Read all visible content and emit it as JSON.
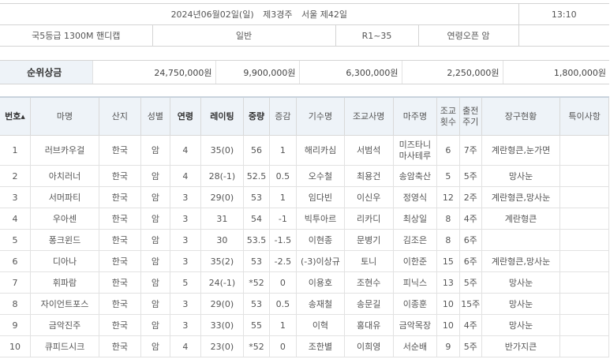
{
  "race": {
    "date": "2024년06월02일(일)",
    "week": "제3경주",
    "venue_race": "서울 제42일",
    "time": "13:10",
    "grade_distance": "국5등급  1300M  핸디캡",
    "type": "일반",
    "rating_range": "R1~35",
    "eligibility": "연령오픈 암"
  },
  "prize": {
    "label": "순위상금",
    "amounts": [
      "24,750,000원",
      "9,900,000원",
      "6,300,000원",
      "2,250,000원",
      "1,800,000원"
    ]
  },
  "columns": {
    "no": "번호",
    "sort_icon": "▲",
    "horse": "마명",
    "origin": "산지",
    "sex": "성별",
    "age": "연령",
    "rating": "레이팅",
    "weight": "중량",
    "weight_change": "증감",
    "jockey": "기수명",
    "trainer": "조교사명",
    "owner": "마주명",
    "train_count_l1": "조교",
    "train_count_l2": "횟수",
    "interval_l1": "출전",
    "interval_l2": "주기",
    "equipment": "장구현황",
    "notes": "특이사항"
  },
  "entries": [
    {
      "no": "1",
      "horse": "러브카우걸",
      "origin": "한국",
      "sex": "암",
      "age": "4",
      "rating": "35(0)",
      "weight": "56",
      "change": "1",
      "jockey": "해리카심",
      "trainer": "서범석",
      "owner_l1": "미즈타니",
      "owner_l2": "마사테루",
      "train_count": "6",
      "interval": "7주",
      "equipment": "계란형큰,눈가면",
      "notes": ""
    },
    {
      "no": "2",
      "horse": "아치러너",
      "origin": "한국",
      "sex": "암",
      "age": "4",
      "rating": "28(-1)",
      "weight": "52.5",
      "change": "0.5",
      "jockey": "오수철",
      "trainer": "최용건",
      "owner_l1": "송암축산",
      "owner_l2": "",
      "train_count": "5",
      "interval": "5주",
      "equipment": "망사눈",
      "notes": ""
    },
    {
      "no": "3",
      "horse": "서머파티",
      "origin": "한국",
      "sex": "암",
      "age": "3",
      "rating": "29(0)",
      "weight": "53",
      "change": "1",
      "jockey": "임다빈",
      "trainer": "이신우",
      "owner_l1": "정영식",
      "owner_l2": "",
      "train_count": "12",
      "interval": "2주",
      "equipment": "계란형큰,망사눈",
      "notes": ""
    },
    {
      "no": "4",
      "horse": "우아센",
      "origin": "한국",
      "sex": "암",
      "age": "3",
      "rating": "31",
      "weight": "54",
      "change": "-1",
      "jockey": "빅투아르",
      "trainer": "리카디",
      "owner_l1": "최상일",
      "owner_l2": "",
      "train_count": "8",
      "interval": "4주",
      "equipment": "계란형큰",
      "notes": ""
    },
    {
      "no": "5",
      "horse": "퐁크윈드",
      "origin": "한국",
      "sex": "암",
      "age": "3",
      "rating": "30",
      "weight": "53.5",
      "change": "-1.5",
      "jockey": "이현종",
      "trainer": "문병기",
      "owner_l1": "김조은",
      "owner_l2": "",
      "train_count": "8",
      "interval": "6주",
      "equipment": "",
      "notes": ""
    },
    {
      "no": "6",
      "horse": "디아나",
      "origin": "한국",
      "sex": "암",
      "age": "3",
      "rating": "35(2)",
      "weight": "53",
      "change": "-2.5",
      "jockey": "(-3)이상규",
      "trainer": "토니",
      "owner_l1": "이한준",
      "owner_l2": "",
      "train_count": "15",
      "interval": "6주",
      "equipment": "계란형큰,망사눈",
      "notes": ""
    },
    {
      "no": "7",
      "horse": "휘파람",
      "origin": "한국",
      "sex": "암",
      "age": "5",
      "rating": "24(-1)",
      "weight": "*52",
      "change": "0",
      "jockey": "이용호",
      "trainer": "조현수",
      "owner_l1": "피닉스",
      "owner_l2": "",
      "train_count": "13",
      "interval": "5주",
      "equipment": "망사눈",
      "notes": ""
    },
    {
      "no": "8",
      "horse": "자이언트포스",
      "origin": "한국",
      "sex": "암",
      "age": "3",
      "rating": "29(0)",
      "weight": "53",
      "change": "0.5",
      "jockey": "송재철",
      "trainer": "송문길",
      "owner_l1": "이종훈",
      "owner_l2": "",
      "train_count": "10",
      "interval": "15주",
      "equipment": "망사눈",
      "notes": ""
    },
    {
      "no": "9",
      "horse": "금악진주",
      "origin": "한국",
      "sex": "암",
      "age": "3",
      "rating": "33(0)",
      "weight": "55",
      "change": "1",
      "jockey": "이혁",
      "trainer": "홍대유",
      "owner_l1": "금악목장",
      "owner_l2": "",
      "train_count": "10",
      "interval": "4주",
      "equipment": "망사눈",
      "notes": ""
    },
    {
      "no": "10",
      "horse": "큐피드시크",
      "origin": "한국",
      "sex": "암",
      "age": "4",
      "rating": "23(0)",
      "weight": "*52",
      "change": "0",
      "jockey": "조한별",
      "trainer": "이희영",
      "owner_l1": "서순배",
      "owner_l2": "",
      "train_count": "9",
      "interval": "5주",
      "equipment": "반가지큰",
      "notes": ""
    }
  ]
}
